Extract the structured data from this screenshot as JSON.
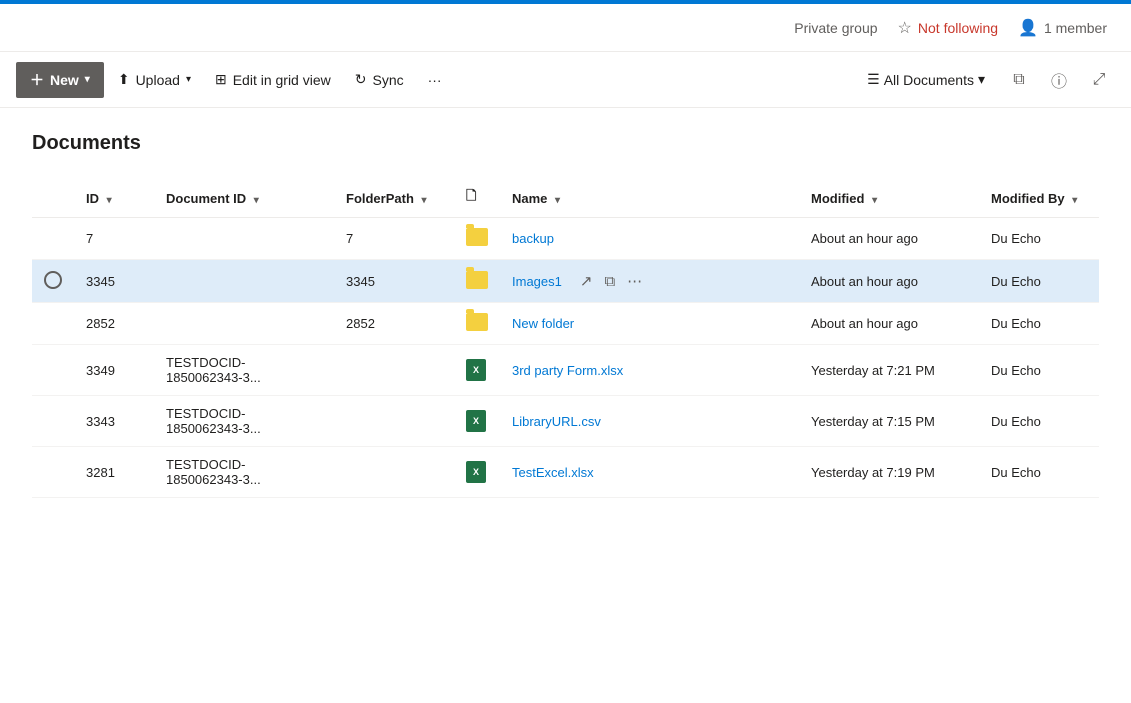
{
  "accent": "#0078d4",
  "topbar": {
    "private_group": "Private group",
    "not_following": "Not following",
    "members": "1 member"
  },
  "commandbar": {
    "new_label": "New",
    "upload_label": "Upload",
    "edit_grid_label": "Edit in grid view",
    "sync_label": "Sync",
    "more_label": "···",
    "view_label": "All Documents",
    "filter_icon": "filter",
    "info_icon": "info",
    "expand_icon": "expand"
  },
  "page": {
    "title": "Documents"
  },
  "table": {
    "columns": [
      {
        "key": "select",
        "label": ""
      },
      {
        "key": "id",
        "label": "ID"
      },
      {
        "key": "docid",
        "label": "Document ID"
      },
      {
        "key": "folderpath",
        "label": "FolderPath"
      },
      {
        "key": "icon",
        "label": ""
      },
      {
        "key": "name",
        "label": "Name"
      },
      {
        "key": "modified",
        "label": "Modified"
      },
      {
        "key": "modifiedby",
        "label": "Modified By"
      }
    ],
    "rows": [
      {
        "id": "7",
        "docid": "",
        "folderpath": "7",
        "type": "folder",
        "name": "backup",
        "modified": "About an hour ago",
        "modifiedby": "Du Echo",
        "selected": false
      },
      {
        "id": "3345",
        "docid": "",
        "folderpath": "3345",
        "type": "folder",
        "name": "Images1",
        "modified": "About an hour ago",
        "modifiedby": "Du Echo",
        "selected": true
      },
      {
        "id": "2852",
        "docid": "",
        "folderpath": "2852",
        "type": "folder",
        "name": "New folder",
        "modified": "About an hour ago",
        "modifiedby": "Du Echo",
        "selected": false
      },
      {
        "id": "3349",
        "docid": "TESTDOCID-1850062343-3...",
        "folderpath": "",
        "type": "excel",
        "name": "3rd party Form.xlsx",
        "modified": "Yesterday at 7:21 PM",
        "modifiedby": "Du Echo",
        "selected": false
      },
      {
        "id": "3343",
        "docid": "TESTDOCID-1850062343-3...",
        "folderpath": "",
        "type": "excel",
        "name": "LibraryURL.csv",
        "modified": "Yesterday at 7:15 PM",
        "modifiedby": "Du Echo",
        "selected": false
      },
      {
        "id": "3281",
        "docid": "TESTDOCID-1850062343-3...",
        "folderpath": "",
        "type": "excel",
        "name": "TestExcel.xlsx",
        "modified": "Yesterday at 7:19 PM",
        "modifiedby": "Du Echo",
        "selected": false
      }
    ]
  }
}
